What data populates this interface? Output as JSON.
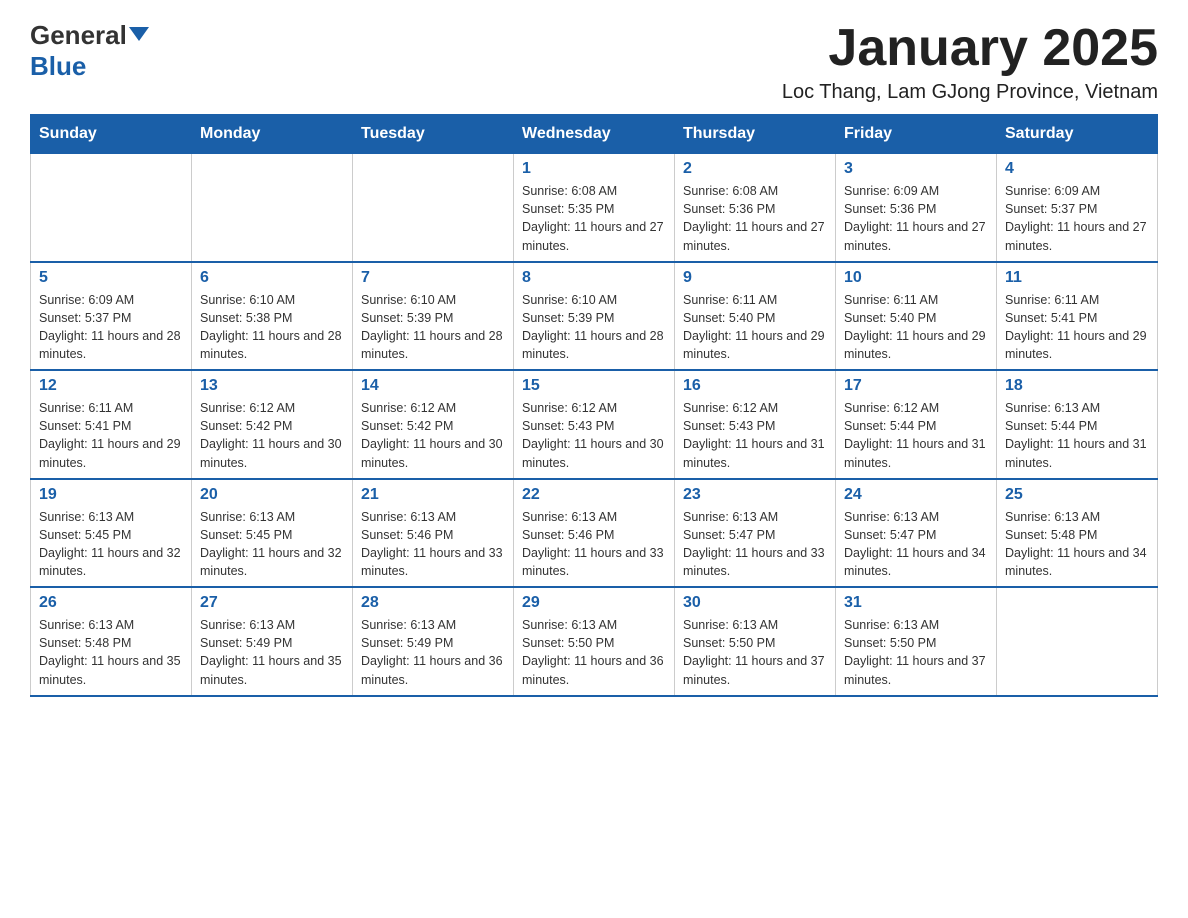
{
  "logo": {
    "general": "General",
    "blue": "Blue"
  },
  "title": "January 2025",
  "subtitle": "Loc Thang, Lam GJong Province, Vietnam",
  "days_of_week": [
    "Sunday",
    "Monday",
    "Tuesday",
    "Wednesday",
    "Thursday",
    "Friday",
    "Saturday"
  ],
  "weeks": [
    [
      {
        "day": "",
        "info": ""
      },
      {
        "day": "",
        "info": ""
      },
      {
        "day": "",
        "info": ""
      },
      {
        "day": "1",
        "info": "Sunrise: 6:08 AM\nSunset: 5:35 PM\nDaylight: 11 hours and 27 minutes."
      },
      {
        "day": "2",
        "info": "Sunrise: 6:08 AM\nSunset: 5:36 PM\nDaylight: 11 hours and 27 minutes."
      },
      {
        "day": "3",
        "info": "Sunrise: 6:09 AM\nSunset: 5:36 PM\nDaylight: 11 hours and 27 minutes."
      },
      {
        "day": "4",
        "info": "Sunrise: 6:09 AM\nSunset: 5:37 PM\nDaylight: 11 hours and 27 minutes."
      }
    ],
    [
      {
        "day": "5",
        "info": "Sunrise: 6:09 AM\nSunset: 5:37 PM\nDaylight: 11 hours and 28 minutes."
      },
      {
        "day": "6",
        "info": "Sunrise: 6:10 AM\nSunset: 5:38 PM\nDaylight: 11 hours and 28 minutes."
      },
      {
        "day": "7",
        "info": "Sunrise: 6:10 AM\nSunset: 5:39 PM\nDaylight: 11 hours and 28 minutes."
      },
      {
        "day": "8",
        "info": "Sunrise: 6:10 AM\nSunset: 5:39 PM\nDaylight: 11 hours and 28 minutes."
      },
      {
        "day": "9",
        "info": "Sunrise: 6:11 AM\nSunset: 5:40 PM\nDaylight: 11 hours and 29 minutes."
      },
      {
        "day": "10",
        "info": "Sunrise: 6:11 AM\nSunset: 5:40 PM\nDaylight: 11 hours and 29 minutes."
      },
      {
        "day": "11",
        "info": "Sunrise: 6:11 AM\nSunset: 5:41 PM\nDaylight: 11 hours and 29 minutes."
      }
    ],
    [
      {
        "day": "12",
        "info": "Sunrise: 6:11 AM\nSunset: 5:41 PM\nDaylight: 11 hours and 29 minutes."
      },
      {
        "day": "13",
        "info": "Sunrise: 6:12 AM\nSunset: 5:42 PM\nDaylight: 11 hours and 30 minutes."
      },
      {
        "day": "14",
        "info": "Sunrise: 6:12 AM\nSunset: 5:42 PM\nDaylight: 11 hours and 30 minutes."
      },
      {
        "day": "15",
        "info": "Sunrise: 6:12 AM\nSunset: 5:43 PM\nDaylight: 11 hours and 30 minutes."
      },
      {
        "day": "16",
        "info": "Sunrise: 6:12 AM\nSunset: 5:43 PM\nDaylight: 11 hours and 31 minutes."
      },
      {
        "day": "17",
        "info": "Sunrise: 6:12 AM\nSunset: 5:44 PM\nDaylight: 11 hours and 31 minutes."
      },
      {
        "day": "18",
        "info": "Sunrise: 6:13 AM\nSunset: 5:44 PM\nDaylight: 11 hours and 31 minutes."
      }
    ],
    [
      {
        "day": "19",
        "info": "Sunrise: 6:13 AM\nSunset: 5:45 PM\nDaylight: 11 hours and 32 minutes."
      },
      {
        "day": "20",
        "info": "Sunrise: 6:13 AM\nSunset: 5:45 PM\nDaylight: 11 hours and 32 minutes."
      },
      {
        "day": "21",
        "info": "Sunrise: 6:13 AM\nSunset: 5:46 PM\nDaylight: 11 hours and 33 minutes."
      },
      {
        "day": "22",
        "info": "Sunrise: 6:13 AM\nSunset: 5:46 PM\nDaylight: 11 hours and 33 minutes."
      },
      {
        "day": "23",
        "info": "Sunrise: 6:13 AM\nSunset: 5:47 PM\nDaylight: 11 hours and 33 minutes."
      },
      {
        "day": "24",
        "info": "Sunrise: 6:13 AM\nSunset: 5:47 PM\nDaylight: 11 hours and 34 minutes."
      },
      {
        "day": "25",
        "info": "Sunrise: 6:13 AM\nSunset: 5:48 PM\nDaylight: 11 hours and 34 minutes."
      }
    ],
    [
      {
        "day": "26",
        "info": "Sunrise: 6:13 AM\nSunset: 5:48 PM\nDaylight: 11 hours and 35 minutes."
      },
      {
        "day": "27",
        "info": "Sunrise: 6:13 AM\nSunset: 5:49 PM\nDaylight: 11 hours and 35 minutes."
      },
      {
        "day": "28",
        "info": "Sunrise: 6:13 AM\nSunset: 5:49 PM\nDaylight: 11 hours and 36 minutes."
      },
      {
        "day": "29",
        "info": "Sunrise: 6:13 AM\nSunset: 5:50 PM\nDaylight: 11 hours and 36 minutes."
      },
      {
        "day": "30",
        "info": "Sunrise: 6:13 AM\nSunset: 5:50 PM\nDaylight: 11 hours and 37 minutes."
      },
      {
        "day": "31",
        "info": "Sunrise: 6:13 AM\nSunset: 5:50 PM\nDaylight: 11 hours and 37 minutes."
      },
      {
        "day": "",
        "info": ""
      }
    ]
  ]
}
